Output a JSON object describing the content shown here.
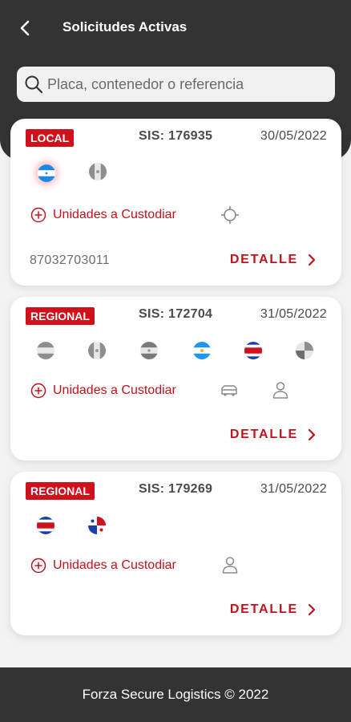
{
  "header": {
    "title": "Solicitudes Activas"
  },
  "search": {
    "placeholder": "Placa, contenedor o referencia"
  },
  "cards": [
    {
      "type": "LOCAL",
      "sis": "SIS: 176935",
      "date": "30/05/2022",
      "flags": [
        "honduras",
        "mexico"
      ],
      "custody_label": "Unidades a Custodiar",
      "icons": [
        "crosshair-icon"
      ],
      "reference": "87032703011",
      "detail_label": "DETALLE"
    },
    {
      "type": "REGIONAL",
      "sis": "SIS: 172704",
      "date": "31/05/2022",
      "flags": [
        "honduras",
        "mexico",
        "el-salvador",
        "nicaragua",
        "costa-rica",
        "panama"
      ],
      "custody_label": "Unidades a Custodiar",
      "icons": [
        "truck-icon",
        "person-icon"
      ],
      "reference": "",
      "detail_label": "DETALLE"
    },
    {
      "type": "REGIONAL",
      "sis": "SIS: 179269",
      "date": "31/05/2022",
      "flags": [
        "costa-rica",
        "panama"
      ],
      "custody_label": "Unidades a Custodiar",
      "icons": [
        "person-icon"
      ],
      "reference": "",
      "detail_label": "DETALLE"
    }
  ],
  "colors": {
    "header": "#333333",
    "accent": "#d0111b",
    "background": "#f3f3f3"
  },
  "footer": {
    "text": "Forza Secure Logistics © 2022"
  }
}
